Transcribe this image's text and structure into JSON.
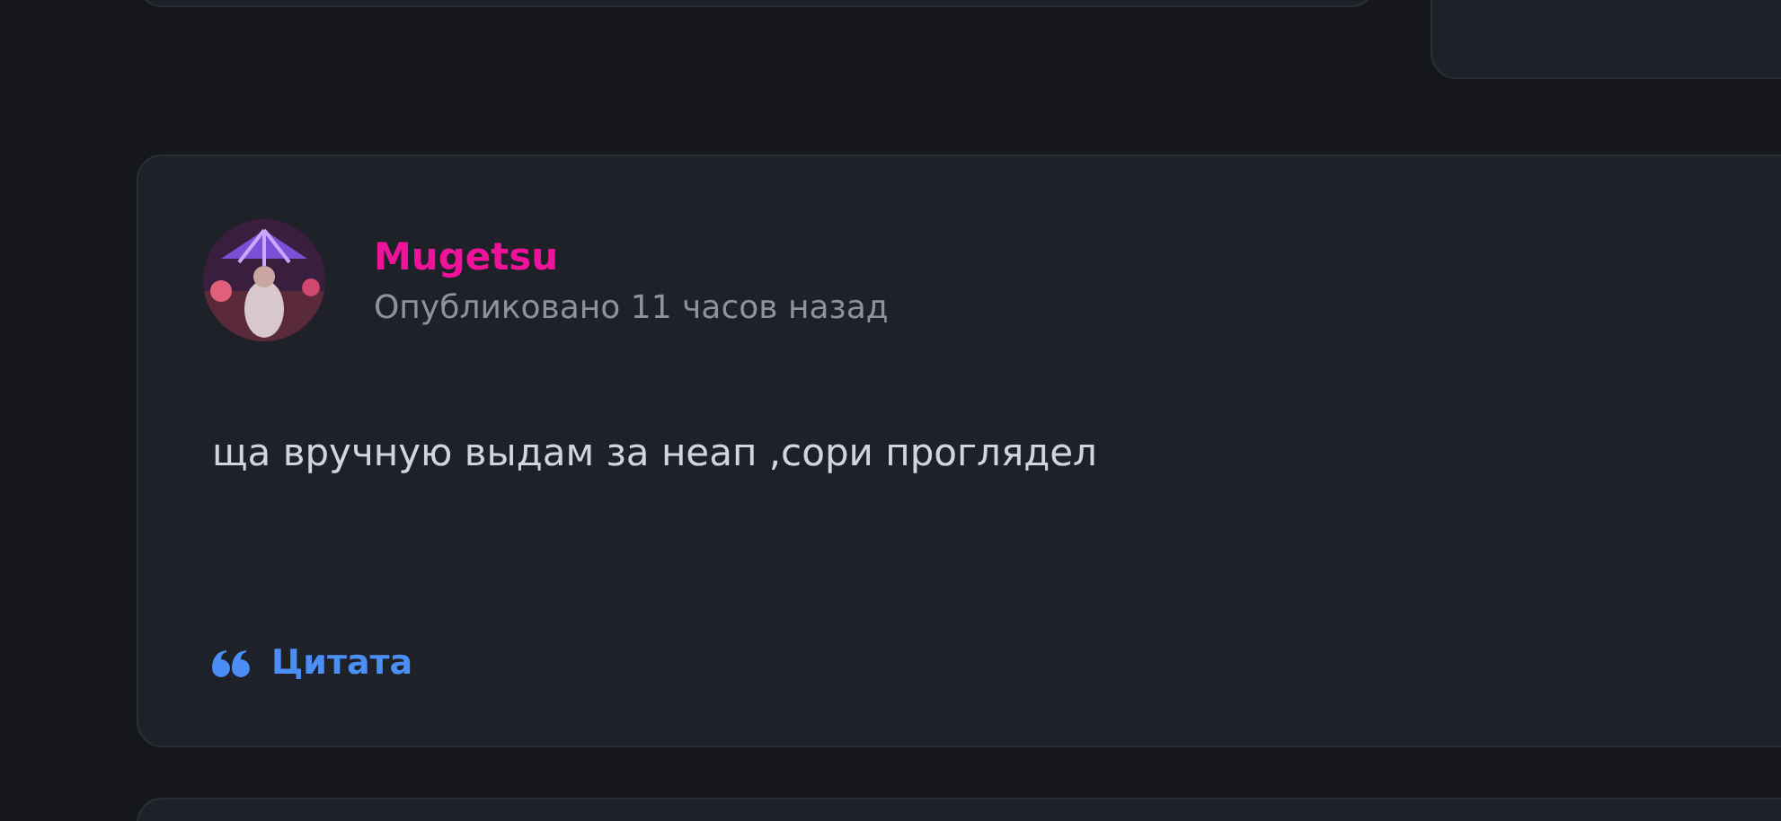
{
  "post": {
    "author": "Mugetsu",
    "meta": "Опубликовано 11 часов назад",
    "body": "ща вручную выдам за неап ,сори проглядел",
    "actions": [
      {
        "kind": "quote",
        "label": "Цитата"
      }
    ]
  }
}
